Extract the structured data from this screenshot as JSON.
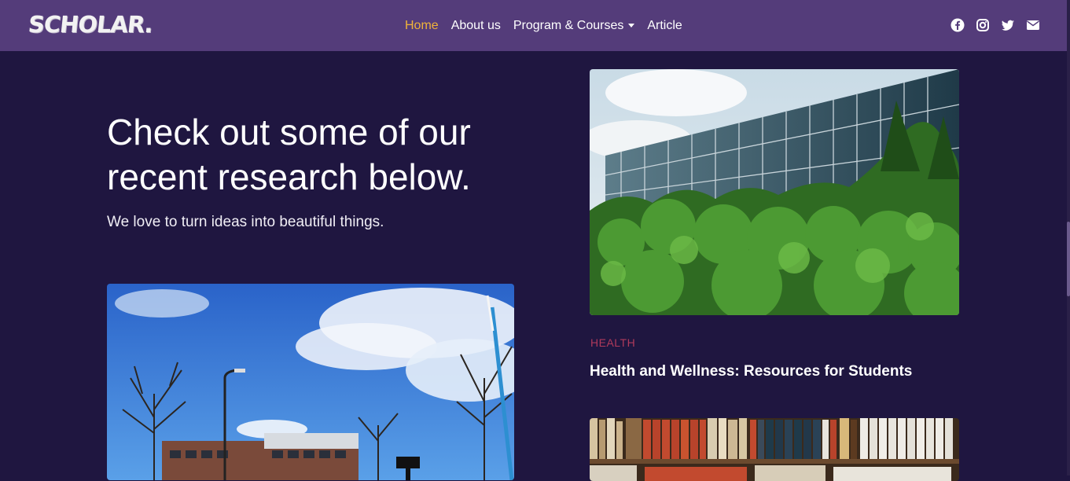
{
  "brand": {
    "logo_text": "SCHOLAR."
  },
  "nav": {
    "items": [
      {
        "label": "Home",
        "active": true
      },
      {
        "label": "About us",
        "active": false
      },
      {
        "label": "Program & Courses",
        "active": false,
        "dropdown": true
      },
      {
        "label": "Article",
        "active": false
      }
    ]
  },
  "social": [
    "facebook-icon",
    "instagram-icon",
    "twitter-icon",
    "envelope-icon"
  ],
  "hero": {
    "title": "Check out some of our recent research below.",
    "subtitle": "We love to turn ideas into beautiful things."
  },
  "card": {
    "category": "HEALTH",
    "title": "Health and Wellness: Resources for Students"
  },
  "colors": {
    "background": "#1f1640",
    "navbar": "#543c7a",
    "active_link": "#f0b33a",
    "category": "#b03a5b"
  }
}
